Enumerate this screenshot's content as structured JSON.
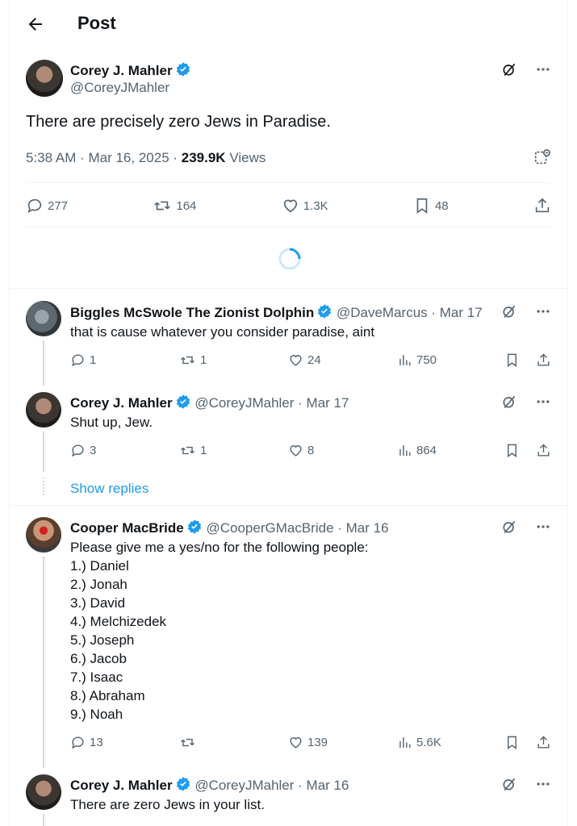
{
  "header": {
    "title": "Post"
  },
  "post": {
    "name": "Corey J. Mahler",
    "handle": "@CoreyJMahler",
    "text": "There are precisely zero Jews in Paradise.",
    "time": "5:38 AM · Mar 16, 2025 · ",
    "views_count": "239.9K",
    "views_label": "Views",
    "stats": {
      "replies": "277",
      "reposts": "164",
      "likes": "1.3K",
      "bookmarks": "48"
    }
  },
  "replies": [
    {
      "name": "Biggles McSwole The Zionist Dolphin",
      "handle": "@DaveMarcus",
      "date": "Mar 17",
      "text": "that is cause whatever you consider paradise, aint",
      "stats": {
        "replies": "1",
        "reposts": "1",
        "likes": "24",
        "views": "750"
      }
    },
    {
      "name": "Corey J. Mahler",
      "handle": "@CoreyJMahler",
      "date": "Mar 17",
      "text": "Shut up, Jew.",
      "stats": {
        "replies": "3",
        "reposts": "1",
        "likes": "8",
        "views": "864"
      }
    },
    {
      "name": "Cooper MacBride",
      "handle": "@CooperGMacBride",
      "date": "Mar 16",
      "text": "Please give me a yes/no for the following people:",
      "list": [
        "1.) Daniel",
        "2.) Jonah",
        "3.) David",
        "4.) Melchizedek",
        "5.) Joseph",
        "6.) Jacob",
        "7.) Isaac",
        "8.) Abraham",
        "9.) Noah"
      ],
      "stats": {
        "replies": "13",
        "reposts": "",
        "likes": "139",
        "views": "5.6K"
      }
    },
    {
      "name": "Corey J. Mahler",
      "handle": "@CoreyJMahler",
      "date": "Mar 16",
      "text": "There are zero Jews in your list."
    }
  ],
  "show_replies": "Show replies",
  "sep": " · ",
  "colors": {
    "accent": "#1d9bf0",
    "muted": "#536471",
    "text": "#0f1419"
  },
  "icons": [
    "back-arrow-icon",
    "verified-badge-icon",
    "grok-icon",
    "more-icon",
    "reply-icon",
    "repost-icon",
    "like-icon",
    "bookmark-icon",
    "share-icon",
    "views-icon",
    "tag-icon"
  ]
}
